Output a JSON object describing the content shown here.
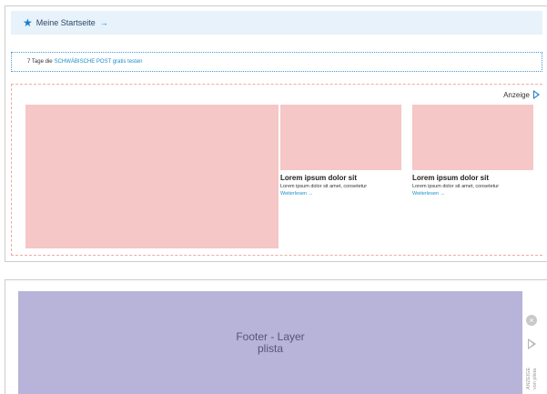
{
  "startseite": {
    "label": "Meine Startseite",
    "arrow": "→",
    "star": "★"
  },
  "promo": {
    "prefix": "7 Tage die",
    "link": "SCHWÄBISCHE POST gratis testen"
  },
  "ad": {
    "label": "Anzeige",
    "teasers": [
      {
        "title": "Lorem ipsum dolor sit",
        "desc": "Lorem ipsum dolor sit amet, consetetur",
        "more": "Weiterlesen →"
      },
      {
        "title": "Lorem ipsum dolor sit",
        "desc": "Lorem ipsum dolor sit amet, consetetur",
        "more": "Weiterlesen →"
      }
    ],
    "placeholder_color": "#f5c7c7"
  },
  "footer": {
    "line1": "Footer - Layer",
    "line2": "plista",
    "close_symbol": "×",
    "side_label_1": "ANZEIGE",
    "side_label_2": "von plista",
    "background_color": "#b8b3d8"
  }
}
